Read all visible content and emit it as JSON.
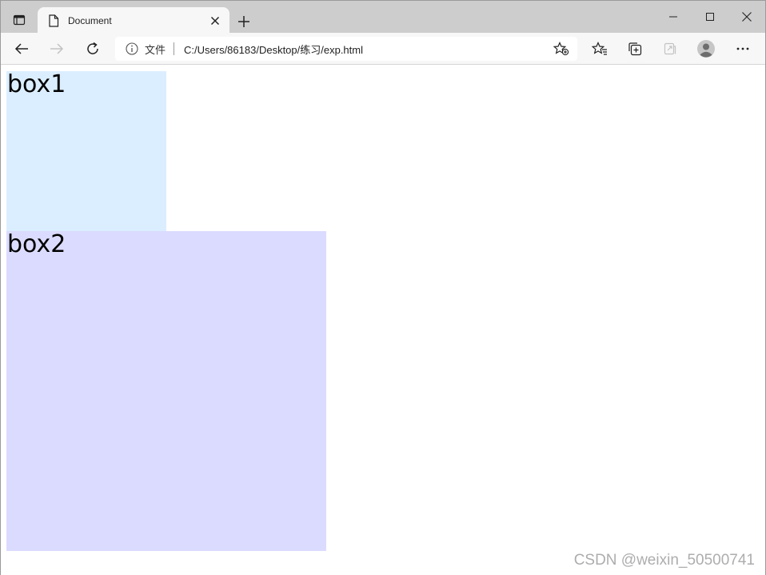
{
  "window": {
    "tab": {
      "title": "Document"
    },
    "controls": [
      "minimize",
      "maximize",
      "close"
    ]
  },
  "toolbar": {
    "address": {
      "site_label": "文件",
      "url": "C:/Users/86183/Desktop/练习/exp.html"
    },
    "icons": [
      "back-icon",
      "forward-icon",
      "refresh-icon",
      "info-icon",
      "add-favorite-icon",
      "favorites-icon",
      "collections-icon",
      "share-icon",
      "profile-icon",
      "more-icon"
    ]
  },
  "page": {
    "box1": {
      "text": "box1",
      "color": "#dbeeff"
    },
    "box2": {
      "text": "box2",
      "color": "#dbdbff"
    }
  },
  "watermark": {
    "text": "CSDN @weixin_50500741"
  },
  "colors": {
    "tabstrip": "#cdcdcd",
    "toolbar": "#f7f7f7",
    "box1": "#dbeeff",
    "box2": "#dbdbff"
  }
}
